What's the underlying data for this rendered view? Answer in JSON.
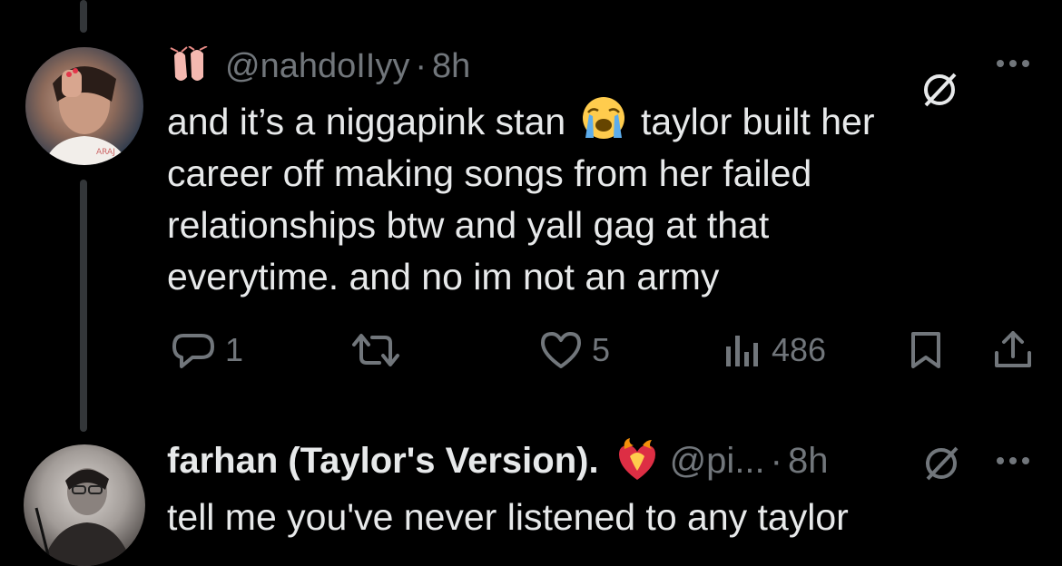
{
  "tweet1": {
    "handle": "@nahdoIIyy",
    "separator": "·",
    "time": "8h",
    "author_emoji": "ballet-shoes-icon",
    "text_part1": "and it’s a niggapink stan",
    "inline_emoji": "loudly-crying-face-icon",
    "text_part2": "taylor built her\ncareer off making songs from her failed\nrelationships btw and yall gag at that\neverytime. and no im not an army",
    "reply_count": "1",
    "like_count": "5",
    "view_count": "486"
  },
  "tweet2": {
    "display_name": "farhan (Taylor's Version).",
    "name_emoji": "heart-on-fire-icon",
    "handle": "@pi...",
    "separator": "·",
    "time": "8h",
    "text": "tell me you've never listened to any taylor"
  },
  "colors": {
    "background": "#000000",
    "text": "#e7e9ea",
    "muted": "#71767b",
    "thread_line": "#333639"
  }
}
